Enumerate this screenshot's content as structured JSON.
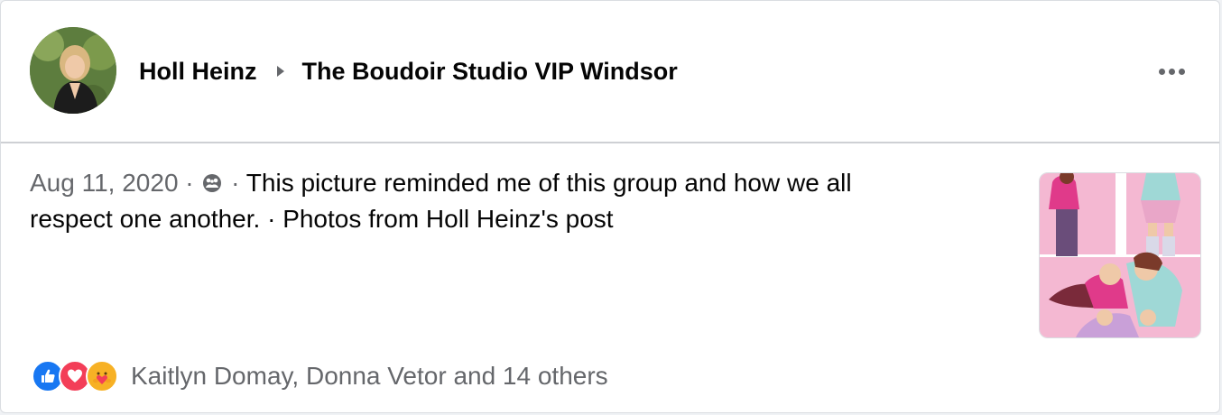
{
  "post": {
    "author": "Holl Heinz",
    "group": "The Boudoir Studio VIP Windsor",
    "date": "Aug 11, 2020",
    "separator": " · ",
    "text_line1": "This picture reminded me of this group and how we all",
    "text_line2": "respect one another.",
    "photos_link": "Photos from Holl Heinz's post",
    "privacy_icon": "group-privacy-icon",
    "more_icon": "more-options-icon"
  },
  "reactions": {
    "icons": [
      "like-icon",
      "love-icon",
      "care-icon"
    ],
    "summary": "Kaitlyn Domay, Donna Vetor and 14 others"
  },
  "colors": {
    "text_primary": "#050505",
    "text_secondary": "#65676b",
    "like_blue": "#1877f2",
    "love_red": "#f33e58",
    "care_yellow": "#f7b125",
    "thumb_pink": "#f4b8d2"
  }
}
